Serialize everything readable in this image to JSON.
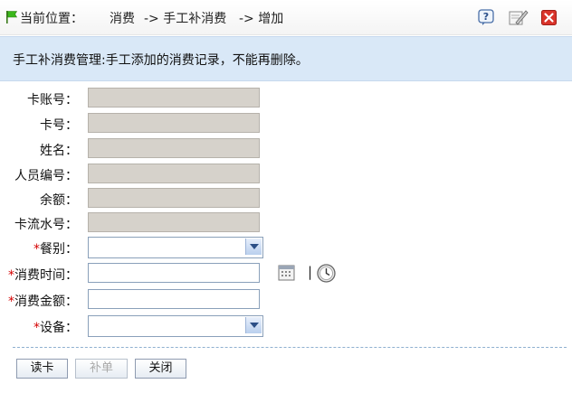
{
  "breadcrumb": {
    "label": "当前位置：",
    "items": [
      "消费",
      "-> 手工补消费",
      "-> 增加"
    ]
  },
  "info": {
    "text": "手工补消费管理:手工添加的消费记录，不能再删除。"
  },
  "form": {
    "fields": [
      {
        "label": "卡账号：",
        "required": false
      },
      {
        "label": "卡号：",
        "required": false
      },
      {
        "label": "姓名：",
        "required": false
      },
      {
        "label": "人员编号：",
        "required": false
      },
      {
        "label": "余额：",
        "required": false
      },
      {
        "label": "卡流水号：",
        "required": false
      },
      {
        "label": "餐别：",
        "required": true
      },
      {
        "label": "消费时间：",
        "required": true
      },
      {
        "label": "消费金额：",
        "required": true
      },
      {
        "label": "设备：",
        "required": true
      }
    ],
    "required_mark": "*",
    "time_separator": "|"
  },
  "buttons": {
    "read_card": "读卡",
    "supplement": "补单",
    "close": "关闭"
  },
  "icons": {
    "toolbar": [
      "help-icon",
      "edit-icon",
      "close-icon"
    ],
    "calendar": "calendar-icon",
    "clock": "clock-icon",
    "flag": "flag-icon"
  },
  "colors": {
    "info_bg": "#d9e8f7",
    "required": "#d40000",
    "readonly_field": "#d6d2cb"
  }
}
